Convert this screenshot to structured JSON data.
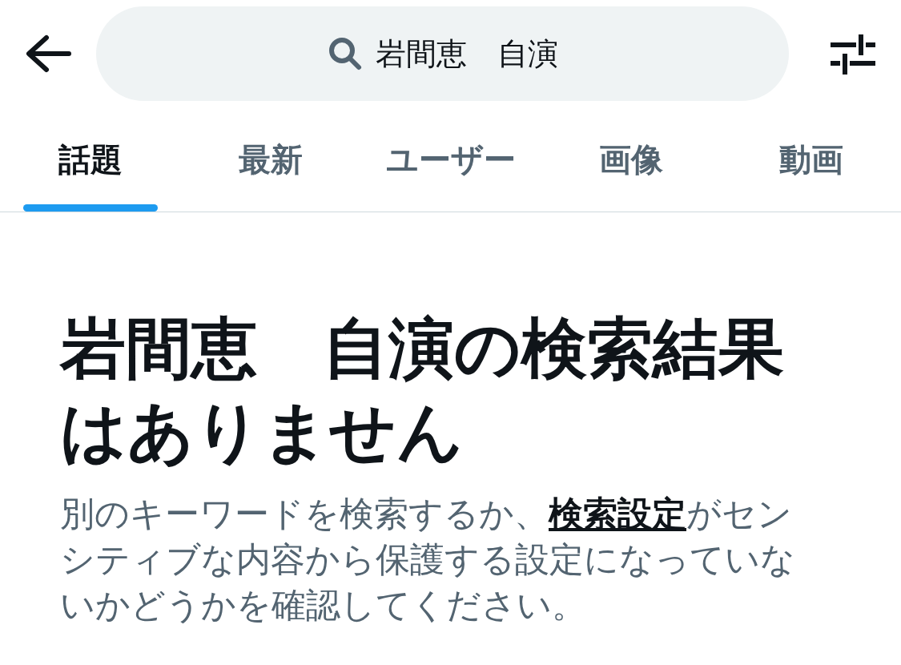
{
  "search": {
    "value": "岩間恵　自演"
  },
  "tabs": [
    {
      "label": "話題",
      "selected": true
    },
    {
      "label": "最新",
      "selected": false
    },
    {
      "label": "ユーザー",
      "selected": false
    },
    {
      "label": "画像",
      "selected": false
    },
    {
      "label": "動画",
      "selected": false
    }
  ],
  "empty_state": {
    "title": "岩間恵　自演の検索結果はありません",
    "message_before": "別のキーワードを検索するか、",
    "link": "検索設定",
    "message_after": "がセンシティブな内容から保護する設定になっていないかどうかを確認してください。"
  }
}
